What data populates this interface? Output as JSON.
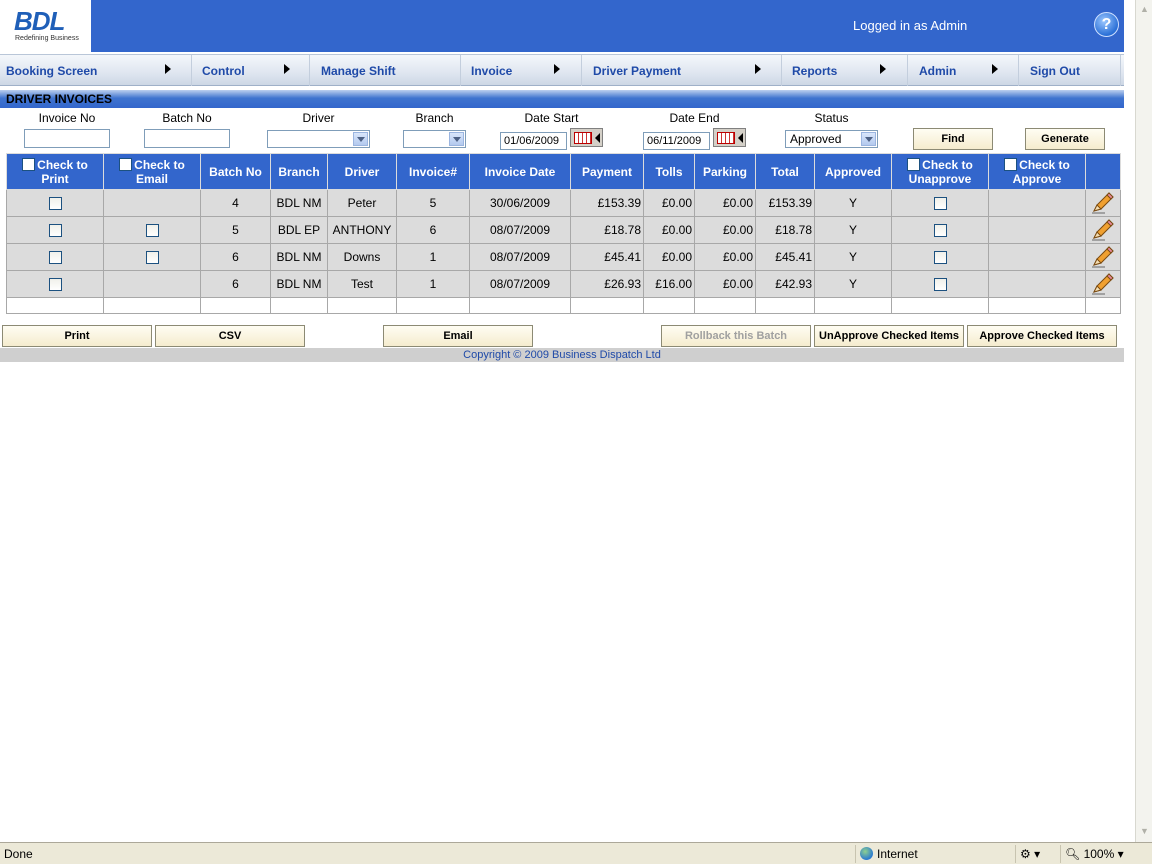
{
  "header": {
    "logo_text": "BDL",
    "logo_tagline": "Redefining Business",
    "login_status": "Logged in as Admin",
    "help_glyph": "?"
  },
  "nav": [
    {
      "label": "Booking Screen",
      "has_submenu": true
    },
    {
      "label": "Control",
      "has_submenu": true
    },
    {
      "label": "Manage Shift",
      "has_submenu": false
    },
    {
      "label": "Invoice",
      "has_submenu": true
    },
    {
      "label": "Driver Payment",
      "has_submenu": true
    },
    {
      "label": "Reports",
      "has_submenu": true
    },
    {
      "label": "Admin",
      "has_submenu": true
    },
    {
      "label": "Sign Out",
      "has_submenu": false
    }
  ],
  "page_title": "DRIVER INVOICES",
  "filters": {
    "invoice_no_label": "Invoice No",
    "invoice_no_value": "",
    "batch_no_label": "Batch No",
    "batch_no_value": "",
    "driver_label": "Driver",
    "driver_value": "",
    "branch_label": "Branch",
    "branch_value": "",
    "date_start_label": "Date Start",
    "date_start_value": "01/06/2009",
    "date_end_label": "Date End",
    "date_end_value": "06/11/2009",
    "status_label": "Status",
    "status_value": "Approved",
    "find_label": "Find",
    "generate_label": "Generate"
  },
  "table": {
    "headers": {
      "check_print": "Check to Print",
      "check_email": "Check to Email",
      "batch_no": "Batch No",
      "branch": "Branch",
      "driver": "Driver",
      "invoice_num": "Invoice#",
      "invoice_date": "Invoice Date",
      "payment": "Payment",
      "tolls": "Tolls",
      "parking": "Parking",
      "total": "Total",
      "approved": "Approved",
      "check_unapprove": "Check to Unapprove",
      "check_approve": "Check to Approve"
    },
    "rows": [
      {
        "email_checkbox": false,
        "batch_no": "4",
        "branch": "BDL NM",
        "driver": "Peter",
        "invoice_num": "5",
        "invoice_date": "30/06/2009",
        "payment": "£153.39",
        "tolls": "£0.00",
        "parking": "£0.00",
        "total": "£153.39",
        "approved": "Y"
      },
      {
        "email_checkbox": true,
        "batch_no": "5",
        "branch": "BDL EP",
        "driver": "ANTHONY",
        "invoice_num": "6",
        "invoice_date": "08/07/2009",
        "payment": "£18.78",
        "tolls": "£0.00",
        "parking": "£0.00",
        "total": "£18.78",
        "approved": "Y"
      },
      {
        "email_checkbox": true,
        "batch_no": "6",
        "branch": "BDL NM",
        "driver": "Downs",
        "invoice_num": "1",
        "invoice_date": "08/07/2009",
        "payment": "£45.41",
        "tolls": "£0.00",
        "parking": "£0.00",
        "total": "£45.41",
        "approved": "Y"
      },
      {
        "email_checkbox": false,
        "batch_no": "6",
        "branch": "BDL NM",
        "driver": "Test",
        "invoice_num": "1",
        "invoice_date": "08/07/2009",
        "payment": "£26.93",
        "tolls": "£16.00",
        "parking": "£0.00",
        "total": "£42.93",
        "approved": "Y"
      }
    ]
  },
  "actions": {
    "print": "Print",
    "csv": "CSV",
    "email": "Email",
    "rollback": "Rollback this Batch",
    "unapprove": "UnApprove Checked Items",
    "approve": "Approve Checked Items"
  },
  "footer": {
    "copyright": "Copyright © 2009 Business Dispatch Ltd"
  },
  "statusbar": {
    "left": "Done",
    "zone": "Internet",
    "zoom": "100%"
  },
  "colors": {
    "header_blue": "#3366cc",
    "nav_text": "#1f4aa8",
    "table_row": "#dcdcdc"
  }
}
